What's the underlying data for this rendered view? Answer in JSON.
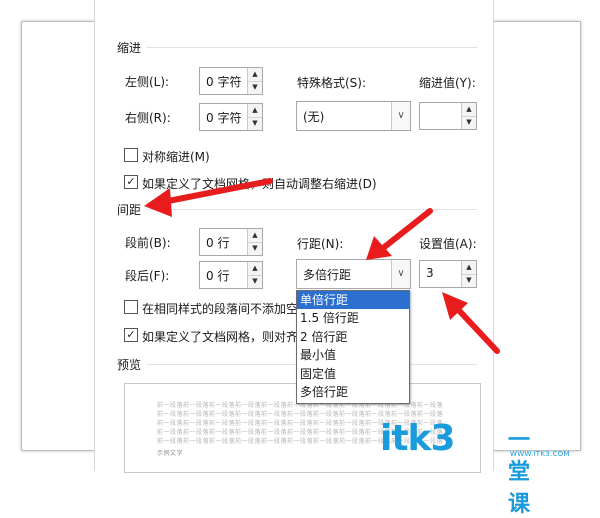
{
  "indent": {
    "section_title": "缩进",
    "left_label": "左侧(L):",
    "left_value": "0 字符",
    "right_label": "右侧(R):",
    "right_value": "0 字符",
    "special_label": "特殊格式(S):",
    "special_value": "(无)",
    "indent_value_label": "缩进值(Y):",
    "indent_value": "",
    "mirror_label": "对称缩进(M)",
    "mirror_checked": false,
    "auto_adjust_label": "如果定义了文档网格，则自动调整右缩进(D)",
    "auto_adjust_checked": true
  },
  "spacing": {
    "section_title": "间距",
    "before_label": "段前(B):",
    "before_value": "0 行",
    "after_label": "段后(F):",
    "after_value": "0 行",
    "line_spacing_label": "行距(N):",
    "line_spacing_value": "多倍行距",
    "set_value_label": "设置值(A):",
    "set_value": "3",
    "no_space_label": "在相同样式的段落间不添加空格",
    "no_space_checked": false,
    "snap_grid_label": "如果定义了文档网格，则对齐到",
    "snap_grid_checked": true
  },
  "line_spacing_options": [
    "单倍行距",
    "1.5 倍行距",
    "2 倍行距",
    "最小值",
    "固定值",
    "多倍行距"
  ],
  "line_spacing_highlighted": "单倍行距",
  "preview": {
    "title": "预览",
    "sample_line": "前一段落前一段落前一段落前一段落前一段落前一段落前一段落前一段落前一段落前一段落前一段落",
    "sample_text": "示例文字"
  },
  "watermark": {
    "logo": "itk3",
    "name": "一堂课",
    "url": "WWW.ITK3.COM"
  },
  "colors": {
    "arrow_red": "#e81c1c",
    "selection_blue": "#2d6fd1",
    "watermark_blue": "#1a9bdc"
  }
}
